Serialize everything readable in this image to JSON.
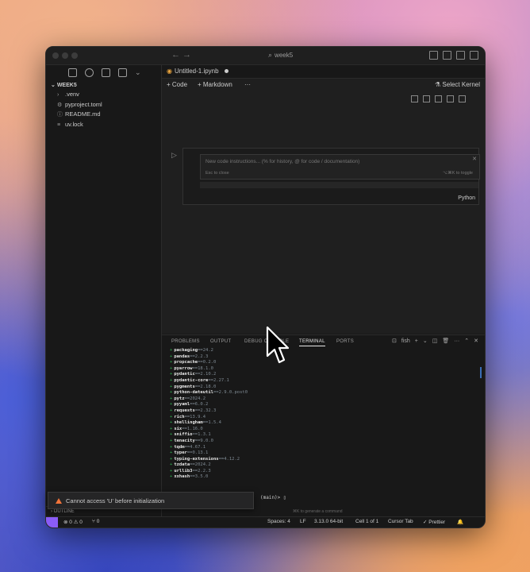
{
  "window": {
    "title": "week5"
  },
  "sidebar": {
    "workspace": "WEEK5",
    "items": [
      {
        "label": ".venv",
        "icon": "chevron-right-icon"
      },
      {
        "label": "pyproject.toml",
        "icon": "gear-file-icon"
      },
      {
        "label": "README.md",
        "icon": "info-file-icon"
      },
      {
        "label": "uv.lock",
        "icon": "lines-file-icon"
      }
    ],
    "outline_label": "OUTLINE"
  },
  "editor": {
    "tab_label": "Untitled-1.ipynb",
    "add_code": "+ Code",
    "add_markdown": "+ Markdown",
    "more": "···",
    "select_kernel": "Select Kernel",
    "prompt_placeholder": "New code instructions... (% for history, @ for code / documentation)",
    "prompt_esc": "Esc to close",
    "prompt_toggle": "⌥⌘K to toggle",
    "cell_language": "Python"
  },
  "panel": {
    "tabs": [
      "PROBLEMS",
      "OUTPUT",
      "DEBUG CONSOLE",
      "TERMINAL",
      "PORTS"
    ],
    "active_tab": "TERMINAL",
    "shell_name": "fish",
    "terminal_lines": [
      {
        "pkg": "packaging",
        "ver": "==24.2"
      },
      {
        "pkg": "pandas",
        "ver": "==2.2.3"
      },
      {
        "pkg": "propcache",
        "ver": "==0.2.0"
      },
      {
        "pkg": "pyarrow",
        "ver": "==18.1.0"
      },
      {
        "pkg": "pydantic",
        "ver": "==2.10.2"
      },
      {
        "pkg": "pydantic-core",
        "ver": "==2.27.1"
      },
      {
        "pkg": "pygments",
        "ver": "==2.18.0"
      },
      {
        "pkg": "python-dateutil",
        "ver": "==2.9.0.post0"
      },
      {
        "pkg": "pytz",
        "ver": "==2024.2"
      },
      {
        "pkg": "pyyaml",
        "ver": "==6.0.2"
      },
      {
        "pkg": "requests",
        "ver": "==2.32.3"
      },
      {
        "pkg": "rich",
        "ver": "==13.9.4"
      },
      {
        "pkg": "shellingham",
        "ver": "==1.5.4"
      },
      {
        "pkg": "six",
        "ver": "==1.16.0"
      },
      {
        "pkg": "sniffio",
        "ver": "==1.3.1"
      },
      {
        "pkg": "tenacity",
        "ver": "==9.0.0"
      },
      {
        "pkg": "tqdm",
        "ver": "==4.67.1"
      },
      {
        "pkg": "typer",
        "ver": "==0.13.1"
      },
      {
        "pkg": "typing-extensions",
        "ver": "==4.12.2"
      },
      {
        "pkg": "tzdata",
        "ver": "==2024.2"
      },
      {
        "pkg": "urllib3",
        "ver": "==2.2.3"
      },
      {
        "pkg": "xxhash",
        "ver": "==3.5.0"
      }
    ],
    "shell_prompt": "(main)> ▯",
    "generate_hint": "⌘K to generate a command"
  },
  "toast": {
    "message": "Cannot access 'U' before initialization"
  },
  "statusbar": {
    "errors": "⊗ 0 ⚠ 0",
    "ports": "⑂ 0",
    "spaces": "Spaces: 4",
    "eol": "LF",
    "python": "3.13.0 64-bit",
    "cell": "Cell 1 of 1",
    "cursor_tab": "Cursor Tab",
    "prettier": "✓ Prettier"
  },
  "colors": {
    "accent": "#8b5cf6",
    "warning": "#f1743a",
    "terminal_plus": "#2fae4e"
  }
}
